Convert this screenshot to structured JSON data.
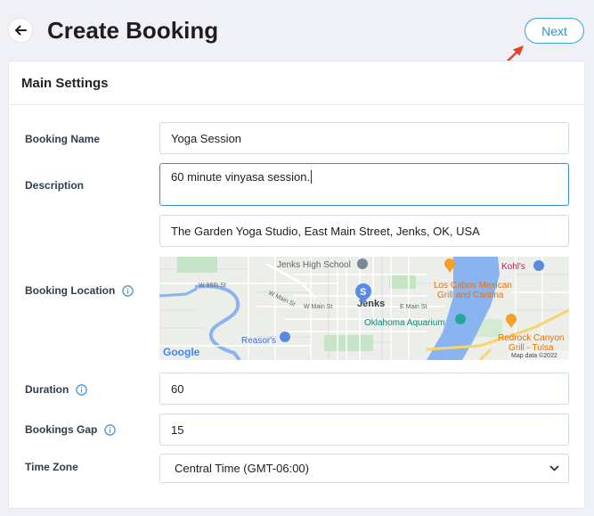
{
  "header": {
    "title": "Create Booking",
    "next_label": "Next"
  },
  "panel": {
    "title": "Main Settings"
  },
  "form": {
    "booking_name": {
      "label": "Booking Name",
      "value": "Yoga Session"
    },
    "description": {
      "label": "Description",
      "value": "60 minute vinyasa session."
    },
    "location": {
      "label": "Booking Location",
      "value": "The Garden Yoga Studio, East Main Street, Jenks, OK, USA"
    },
    "duration": {
      "label": "Duration",
      "value": "60"
    },
    "bookings_gap": {
      "label": "Bookings Gap",
      "value": "15"
    },
    "time_zone": {
      "label": "Time Zone",
      "value": "Central Time (GMT-06:00)"
    }
  },
  "map": {
    "labels": {
      "school": "Jenks High School",
      "kohls": "Kohl's",
      "w96": "W 96th St",
      "wmain1": "W Main St",
      "wmain2": "W Main St",
      "emain": "E Main St",
      "jenks": "Jenks",
      "loscabos1": "Los Cabos Mexican",
      "loscabos2": "Grill and Cantina",
      "aquarium": "Oklahoma Aquarium",
      "reasors": "Reasor's",
      "redrock1": "Redrock Canyon",
      "redrock2": "Grill - Tulsa",
      "google": "Google",
      "mapdata": "Map data ©2022",
      "pin": "S"
    }
  },
  "colors": {
    "accent": "#3aa0d6",
    "annotation_arrow": "#e8401c",
    "map_water": "#8ab4f0",
    "map_park": "#c5e5c4",
    "pin_blue": "#5a8be0",
    "pin_orange": "#f4a02c",
    "pin_teal": "#26a69a"
  }
}
